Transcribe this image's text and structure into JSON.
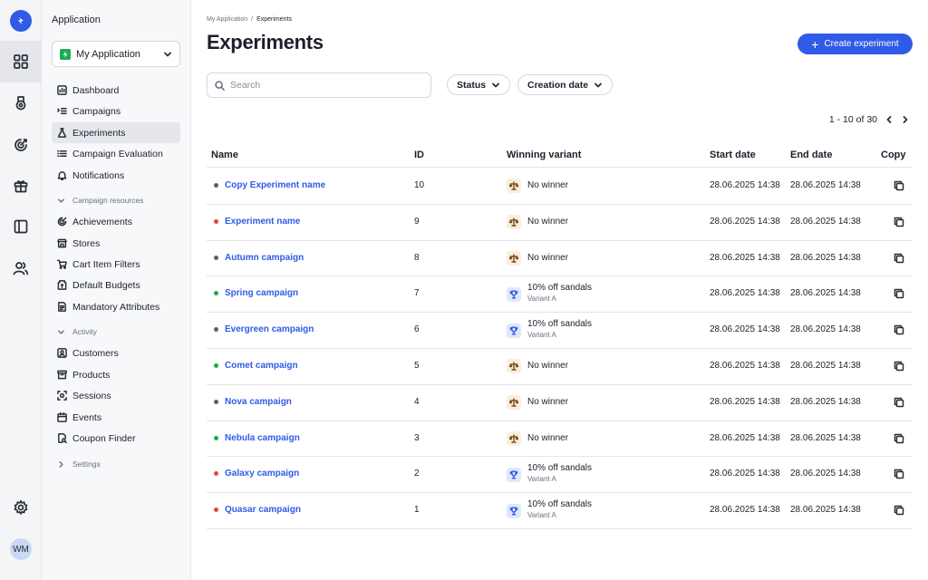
{
  "colors": {
    "accent": "#2f5be6",
    "status_active": "#22a74f",
    "status_draft": "#5b5f6e",
    "status_stopped": "#e0463a"
  },
  "sidebar": {
    "title": "Application",
    "app_select": "My Application",
    "items": [
      {
        "label": "Dashboard",
        "icon": "dashboard-icon"
      },
      {
        "label": "Campaigns",
        "icon": "campaigns-icon"
      },
      {
        "label": "Experiments",
        "icon": "flask-icon"
      },
      {
        "label": "Campaign Evaluation",
        "icon": "list-icon"
      },
      {
        "label": "Notifications",
        "icon": "bell-icon"
      }
    ],
    "section_resources": "Campaign resources",
    "resources": [
      {
        "label": "Achievements",
        "icon": "achievement-icon"
      },
      {
        "label": "Stores",
        "icon": "store-icon"
      },
      {
        "label": "Cart Item Filters",
        "icon": "cart-icon"
      },
      {
        "label": "Default Budgets",
        "icon": "budget-icon"
      },
      {
        "label": "Mandatory Attributes",
        "icon": "attributes-icon"
      }
    ],
    "section_activity": "Activity",
    "activity": [
      {
        "label": "Customers",
        "icon": "customers-icon"
      },
      {
        "label": "Products",
        "icon": "products-icon"
      },
      {
        "label": "Sessions",
        "icon": "sessions-icon"
      },
      {
        "label": "Events",
        "icon": "events-icon"
      },
      {
        "label": "Coupon Finder",
        "icon": "coupon-icon"
      }
    ],
    "section_settings": "Settings"
  },
  "rail": {
    "avatar": "WM"
  },
  "breadcrumb": {
    "parent": "My Application",
    "sep": "/",
    "current": "Experiments"
  },
  "page": {
    "title": "Experiments",
    "create_label": "Create experiment"
  },
  "search": {
    "placeholder": "Search",
    "value": ""
  },
  "filters": {
    "status": "Status",
    "creation_date": "Creation date"
  },
  "pager": {
    "range": "1 - 10 of 30"
  },
  "table": {
    "headers": {
      "name": "Name",
      "id": "ID",
      "winning": "Winning variant",
      "start": "Start date",
      "end": "End date",
      "copy": "Copy"
    },
    "rows": [
      {
        "name": "Copy Experiment name",
        "status": "draft",
        "id": "10",
        "winner": "No winner",
        "variant": "",
        "icon": "scale-icon",
        "start": "28.06.2025 14:38",
        "end": "28.06.2025 14:38"
      },
      {
        "name": "Experiment name",
        "status": "stopped",
        "id": "9",
        "winner": "No winner",
        "variant": "",
        "icon": "scale-icon",
        "start": "28.06.2025 14:38",
        "end": "28.06.2025 14:38"
      },
      {
        "name": "Autumn campaign",
        "status": "draft",
        "id": "8",
        "winner": "No winner",
        "variant": "",
        "icon": "scale-icon",
        "start": "28.06.2025 14:38",
        "end": "28.06.2025 14:38"
      },
      {
        "name": "Spring campaign",
        "status": "active",
        "id": "7",
        "winner": "10% off sandals",
        "variant": "Variant A",
        "icon": "trophy-icon",
        "start": "28.06.2025 14:38",
        "end": "28.06.2025 14:38"
      },
      {
        "name": "Evergreen campaign",
        "status": "draft",
        "id": "6",
        "winner": "10% off sandals",
        "variant": "Variant A",
        "icon": "trophy-icon",
        "start": "28.06.2025 14:38",
        "end": "28.06.2025 14:38"
      },
      {
        "name": "Comet campaign",
        "status": "active",
        "id": "5",
        "winner": "No winner",
        "variant": "",
        "icon": "scale-icon",
        "start": "28.06.2025 14:38",
        "end": "28.06.2025 14:38"
      },
      {
        "name": "Nova campaign",
        "status": "draft",
        "id": "4",
        "winner": "No winner",
        "variant": "",
        "icon": "scale-icon",
        "start": "28.06.2025 14:38",
        "end": "28.06.2025 14:38"
      },
      {
        "name": "Nebula campaign",
        "status": "active",
        "id": "3",
        "winner": "No winner",
        "variant": "",
        "icon": "scale-icon",
        "start": "28.06.2025 14:38",
        "end": "28.06.2025 14:38"
      },
      {
        "name": "Galaxy campaign",
        "status": "stopped",
        "id": "2",
        "winner": "10% off sandals",
        "variant": "Variant A",
        "icon": "trophy-icon",
        "start": "28.06.2025 14:38",
        "end": "28.06.2025 14:38"
      },
      {
        "name": "Quasar campaign",
        "status": "stopped",
        "id": "1",
        "winner": "10% off sandals",
        "variant": "Variant A",
        "icon": "trophy-icon",
        "start": "28.06.2025 14:38",
        "end": "28.06.2025 14:38"
      }
    ]
  }
}
